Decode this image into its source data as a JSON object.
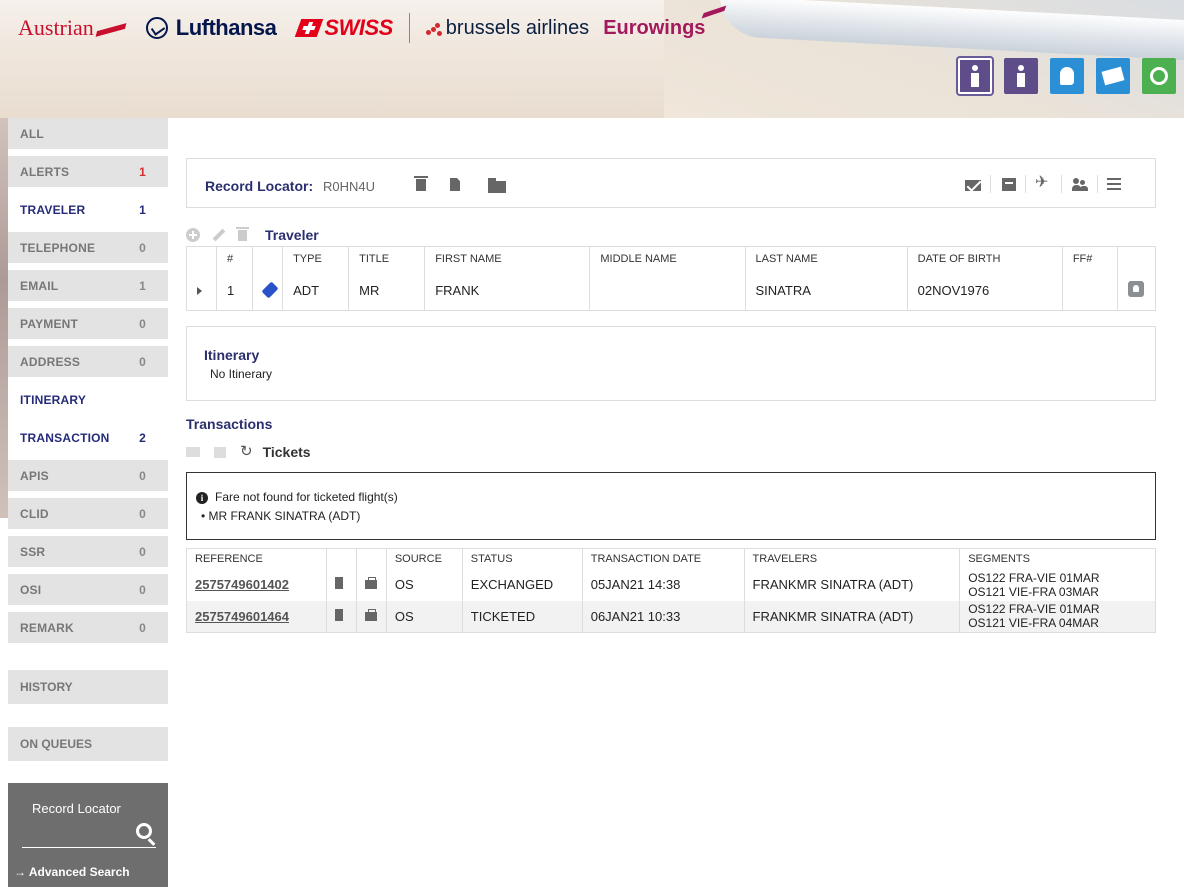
{
  "header": {
    "brands": {
      "austrian": "Austrian",
      "lufthansa": "Lufthansa",
      "swiss": "SWISS",
      "brussels": "brussels airlines",
      "eurowings": "Eurowings"
    },
    "icons": [
      "person-icon",
      "person-icon",
      "head-icon",
      "tickets-icon",
      "leaf-icon"
    ],
    "colors": {
      "purple": "#5f4d8a",
      "blue": "#2b8fd6",
      "green": "#4caf50"
    }
  },
  "sidebar": {
    "items": [
      {
        "label": "ALL",
        "count": ""
      },
      {
        "label": "ALERTS",
        "count": "1"
      },
      {
        "label": "TRAVELER",
        "count": "1"
      },
      {
        "label": "TELEPHONE",
        "count": "0"
      },
      {
        "label": "EMAIL",
        "count": "1"
      },
      {
        "label": "PAYMENT",
        "count": "0"
      },
      {
        "label": "ADDRESS",
        "count": "0"
      },
      {
        "label": "ITINERARY",
        "count": ""
      },
      {
        "label": "TRANSACTION",
        "count": "2"
      },
      {
        "label": "APIS",
        "count": "0"
      },
      {
        "label": "CLID",
        "count": "0"
      },
      {
        "label": "SSR",
        "count": "0"
      },
      {
        "label": "OSI",
        "count": "0"
      },
      {
        "label": "REMARK",
        "count": "0"
      }
    ],
    "history": "HISTORY",
    "on_queues": "ON QUEUES",
    "search": {
      "label": "Record Locator",
      "advanced": "→ Advanced Search"
    }
  },
  "record": {
    "label": "Record Locator:",
    "value": "R0HN4U"
  },
  "traveler": {
    "title": "Traveler",
    "columns": [
      "#",
      "TYPE",
      "TITLE",
      "FIRST NAME",
      "MIDDLE NAME",
      "LAST NAME",
      "DATE OF BIRTH",
      "FF#"
    ],
    "row": {
      "num": "1",
      "type": "ADT",
      "title": "MR",
      "first": "FRANK",
      "middle": "",
      "last": "SINATRA",
      "dob": "02NOV1976",
      "ff": ""
    }
  },
  "itinerary": {
    "title": "Itinerary",
    "empty": "No Itinerary"
  },
  "transactions": {
    "title": "Transactions",
    "tickets_label": "Tickets",
    "alert": {
      "message": "Fare not found for ticketed flight(s)",
      "detail": "• MR FRANK SINATRA (ADT)"
    },
    "columns": [
      "REFERENCE",
      "",
      "",
      "SOURCE",
      "STATUS",
      "TRANSACTION DATE",
      "TRAVELERS",
      "SEGMENTS"
    ],
    "rows": [
      {
        "ref": "2575749601402",
        "source": "OS",
        "status": "EXCHANGED",
        "date": "05JAN21 14:38",
        "travelers": "FRANKMR SINATRA (ADT)",
        "seg1": "OS122 FRA-VIE 01MAR",
        "seg2": "OS121 VIE-FRA 03MAR"
      },
      {
        "ref": "2575749601464",
        "source": "OS",
        "status": "TICKETED",
        "date": "06JAN21 10:33",
        "travelers": "FRANKMR SINATRA (ADT)",
        "seg1": "OS122 FRA-VIE 01MAR",
        "seg2": "OS121 VIE-FRA 04MAR"
      }
    ]
  }
}
